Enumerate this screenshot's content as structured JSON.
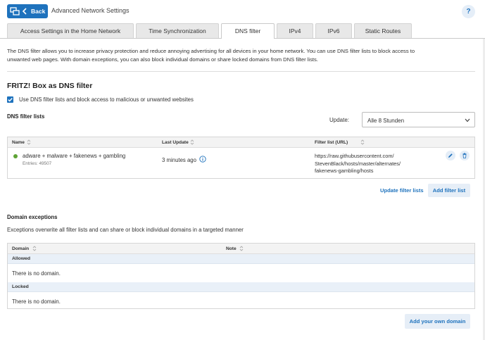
{
  "header": {
    "back_label": "Back",
    "title": "Advanced Network Settings",
    "help_label": "?"
  },
  "tabs": [
    {
      "label": "Access Settings in the Home Network",
      "active": false
    },
    {
      "label": "Time Synchronization",
      "active": false
    },
    {
      "label": "DNS filter",
      "active": true
    },
    {
      "label": "IPv4",
      "active": false
    },
    {
      "label": "IPv6",
      "active": false
    },
    {
      "label": "Static Routes",
      "active": false
    }
  ],
  "intro": {
    "line1": "The DNS filter allows you to increase privacy protection and reduce annoying advertising for all devices in your home network. You can use DNS filter lists to block access to",
    "line2": "unwanted web pages. With domain exceptions, you can also block individual domains or share locked domains from DNS filter lists."
  },
  "fritz": {
    "heading": "FRITZ! Box as DNS filter",
    "checkbox_label": "Use DNS filter lists and block access to malicious or unwanted websites",
    "checkbox_checked": true
  },
  "filter_lists": {
    "heading": "DNS filter lists",
    "update_label": "Update:",
    "update_value": "Alle 8 Stunden",
    "columns": {
      "name": "Name",
      "last_update": "Last Update",
      "url": "Filter list (URL)"
    },
    "rows": [
      {
        "name": "adware + malware + fakenews + gambling",
        "entries": "Entries: 49507",
        "last_update": "3 minutes ago",
        "url_lines": [
          "https://raw.githubusercontent.com/",
          "StevenBlack/hosts/master/alternates/",
          "fakenews-gambling/hosts"
        ],
        "status_color": "#5ea335"
      }
    ],
    "update_link": "Update filter lists",
    "add_button": "Add filter list"
  },
  "domain_exceptions": {
    "heading": "Domain exceptions",
    "description": "Exceptions overwrite all filter lists and can share or block individual domains in a targeted manner",
    "columns": {
      "domain": "Domain",
      "note": "Note"
    },
    "groups": [
      {
        "label": "Allowed",
        "empty": "There is no domain."
      },
      {
        "label": "Locked",
        "empty": "There is no domain."
      }
    ],
    "add_button": "Add your own domain"
  },
  "colors": {
    "accent": "#1e72bd",
    "light_accent": "#e6eef7",
    "group_bg": "#e9f0f8"
  }
}
